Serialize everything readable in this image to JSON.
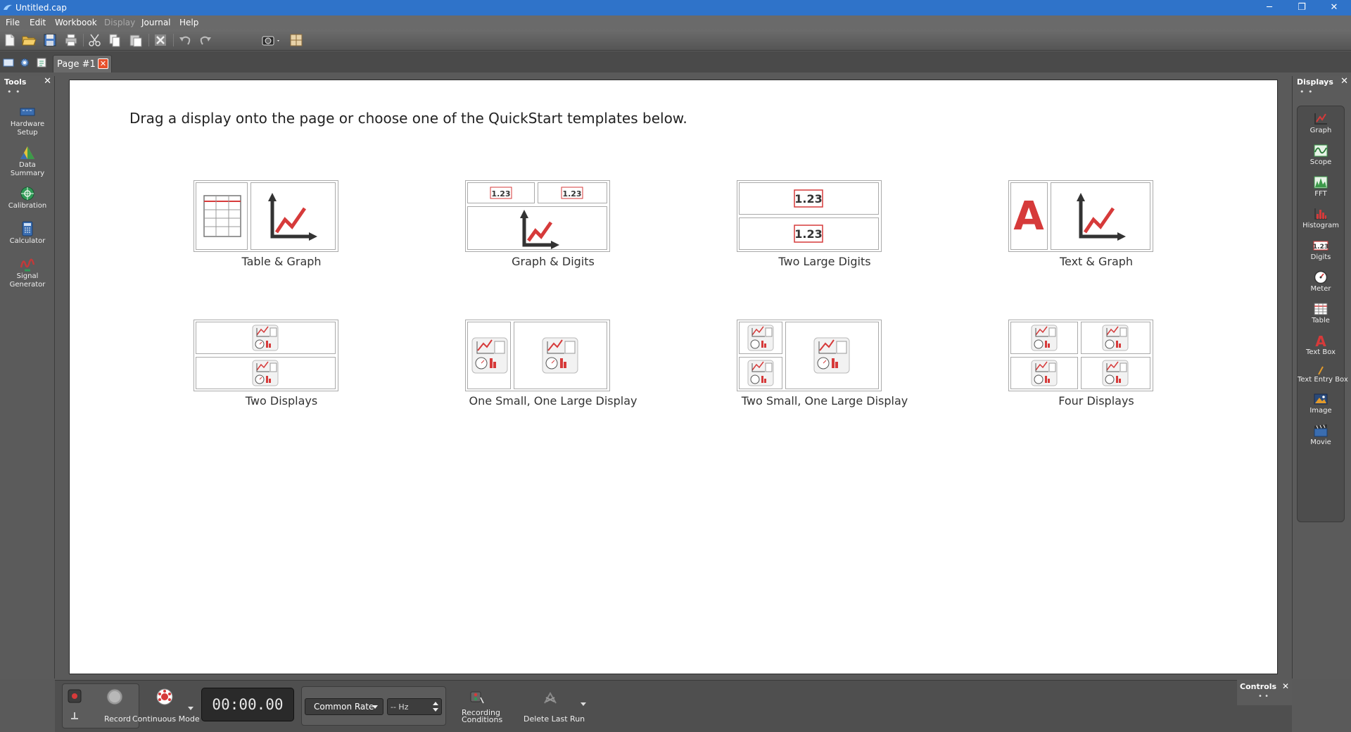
{
  "window": {
    "title": "Untitled.cap",
    "minimize": "─",
    "restore": "❐",
    "close": "✕"
  },
  "menu": {
    "items": [
      "File",
      "Edit",
      "Workbook",
      "Display",
      "Journal",
      "Help"
    ]
  },
  "tabs": {
    "page_label": "Page #1",
    "close_glyph": "✕"
  },
  "tools_panel": {
    "title": "Tools",
    "close_glyph": "✕",
    "dots": "• •",
    "items": [
      {
        "label_line1": "Hardware",
        "label_line2": "Setup",
        "icon": "hardware-setup-icon"
      },
      {
        "label_line1": "Data",
        "label_line2": "Summary",
        "icon": "data-summary-icon"
      },
      {
        "label_line1": "Calibration",
        "label_line2": "",
        "icon": "calibration-icon"
      },
      {
        "label_line1": "Calculator",
        "label_line2": "",
        "icon": "calculator-icon"
      },
      {
        "label_line1": "Signal",
        "label_line2": "Generator",
        "icon": "signal-generator-icon"
      }
    ]
  },
  "displays_panel": {
    "title": "Displays",
    "close_glyph": "✕",
    "dots": "• •",
    "items": [
      {
        "label": "Graph",
        "icon": "graph-icon"
      },
      {
        "label": "Scope",
        "icon": "scope-icon"
      },
      {
        "label": "FFT",
        "icon": "fft-icon"
      },
      {
        "label": "Histogram",
        "icon": "histogram-icon"
      },
      {
        "label": "Digits",
        "icon": "digits-icon"
      },
      {
        "label": "Meter",
        "icon": "meter-icon"
      },
      {
        "label": "Table",
        "icon": "table-icon"
      },
      {
        "label": "Text Box",
        "icon": "text-box-icon"
      },
      {
        "label": "Text Entry Box",
        "icon": "text-entry-box-icon"
      },
      {
        "label": "Image",
        "icon": "image-icon"
      },
      {
        "label": "Movie",
        "icon": "movie-icon"
      }
    ]
  },
  "page": {
    "instruction": "Drag a display onto the page or choose one of the QuickStart templates below.",
    "templates": [
      {
        "label": "Table & Graph"
      },
      {
        "label": "Graph & Digits",
        "digit_text": "1.23"
      },
      {
        "label": "Two Large Digits",
        "digit_text": "1.23"
      },
      {
        "label": "Text & Graph",
        "text_glyph": "A"
      },
      {
        "label": "Two Displays"
      },
      {
        "label": "One Small, One Large Display"
      },
      {
        "label": "Two Small, One Large Display"
      },
      {
        "label": "Four Displays"
      }
    ]
  },
  "controls": {
    "record_label": "Record",
    "mode_label": "Continuous Mode",
    "timer": "00:00.00",
    "rate_label": "Common Rate",
    "hz_value": "-- Hz",
    "recording_conditions_line1": "Recording",
    "recording_conditions_line2": "Conditions",
    "delete_last_run": "Delete Last Run",
    "panel_title": "Controls",
    "panel_close": "✕",
    "panel_dots": "• •"
  },
  "colors": {
    "titlebar": "#2f73c9",
    "accent_red": "#d63a3a",
    "graph_arrow": "#333333"
  }
}
